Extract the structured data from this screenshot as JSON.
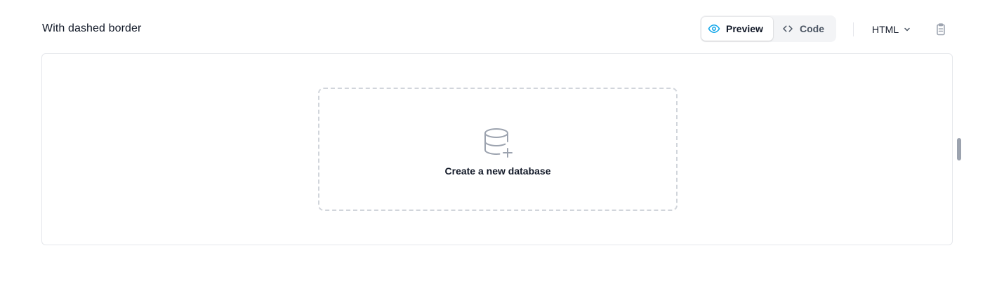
{
  "section": {
    "title": "With dashed border"
  },
  "toolbar": {
    "preview_label": "Preview",
    "code_label": "Code",
    "language": "HTML",
    "active_tab": "Preview",
    "accent_color": "#0ea5e9"
  },
  "icons": {
    "preview": "eye-icon",
    "code": "code-brackets-icon",
    "language_dropdown": "chevron-down-icon",
    "copy": "clipboard-icon",
    "empty_state": "database-add-icon"
  },
  "empty_state": {
    "label": "Create a new database"
  }
}
